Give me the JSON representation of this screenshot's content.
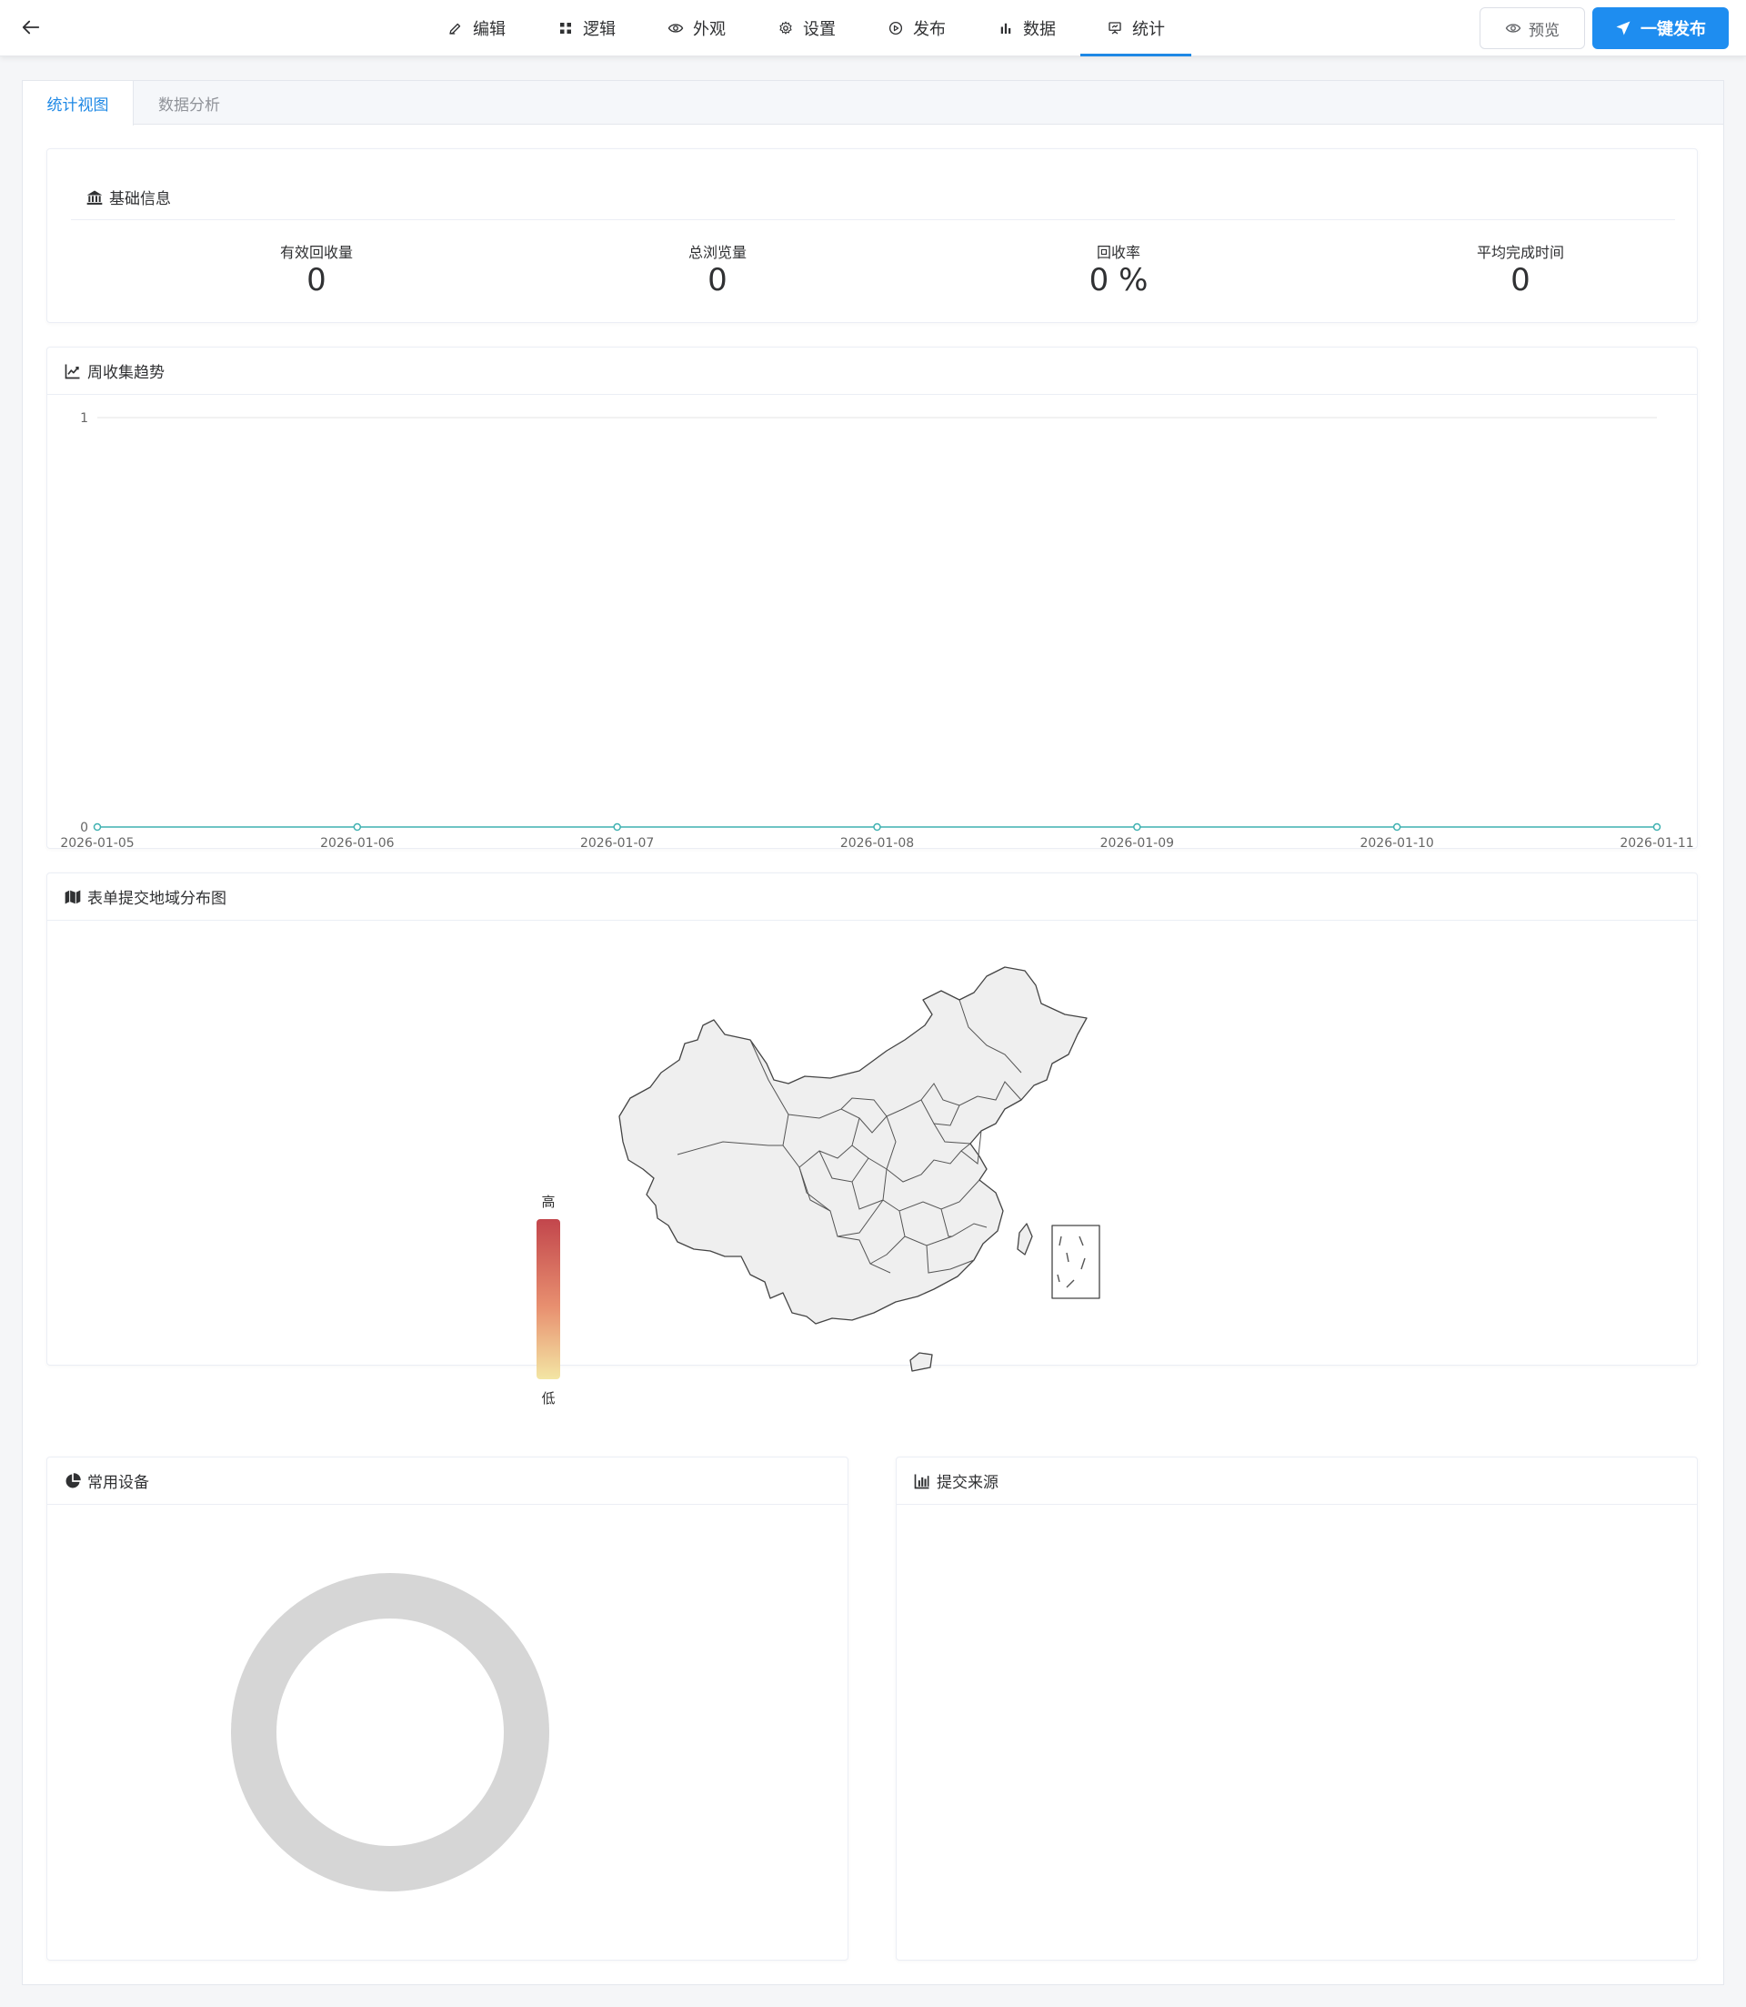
{
  "topbar": {
    "tabs": [
      {
        "label": "编辑",
        "icon": "edit-icon"
      },
      {
        "label": "逻辑",
        "icon": "logic-grid-icon"
      },
      {
        "label": "外观",
        "icon": "eye-icon"
      },
      {
        "label": "设置",
        "icon": "gear-icon"
      },
      {
        "label": "发布",
        "icon": "play-circle-icon"
      },
      {
        "label": "数据",
        "icon": "bar-chart-icon"
      },
      {
        "label": "统计",
        "icon": "presentation-icon"
      }
    ],
    "active_tab": "统计",
    "preview_label": "预览",
    "publish_label": "一键发布",
    "accent_color": "#1e88e5"
  },
  "subtabs": {
    "items": [
      "统计视图",
      "数据分析"
    ],
    "active": "统计视图"
  },
  "basic_info": {
    "title": "基础信息",
    "stats": [
      {
        "label": "有效回收量",
        "value": "0"
      },
      {
        "label": "总浏览量",
        "value": "0"
      },
      {
        "label": "回收率",
        "value": "0 %"
      },
      {
        "label": "平均完成时间",
        "value": "0"
      }
    ]
  },
  "trend": {
    "title": "周收集趋势"
  },
  "map": {
    "title": "表单提交地域分布图",
    "legend_high": "高",
    "legend_low": "低"
  },
  "devices": {
    "title": "常用设备"
  },
  "sources": {
    "title": "提交来源"
  },
  "chart_data": [
    {
      "type": "line",
      "title": "周收集趋势",
      "x": [
        "2026-01-05",
        "2026-01-06",
        "2026-01-07",
        "2026-01-08",
        "2026-01-09",
        "2026-01-10",
        "2026-01-11"
      ],
      "values": [
        0,
        0,
        0,
        0,
        0,
        0,
        0
      ],
      "ylim": [
        0,
        1
      ],
      "y_ticks": [
        "0",
        "1"
      ],
      "grid": true,
      "line_color": "#3fb1b1"
    },
    {
      "type": "pie",
      "title": "常用设备",
      "values": [],
      "empty_ring_color": "#d6d6d6"
    }
  ]
}
